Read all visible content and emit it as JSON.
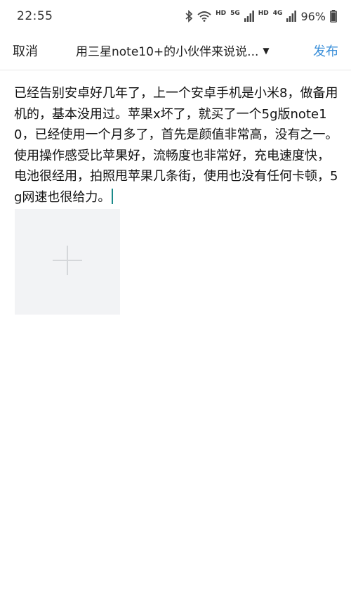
{
  "status_bar": {
    "time": "22:55",
    "network_label_1": "HD",
    "network_label_2": "5G",
    "network_label_3": "HD",
    "network_label_4": "4G",
    "battery": "96%",
    "icons": [
      "bluetooth-icon",
      "wifi-icon",
      "signal-icon",
      "signal-icon",
      "battery-icon"
    ]
  },
  "header": {
    "cancel_label": "取消",
    "topic_label": "用三星note10+的小伙伴来说说...",
    "publish_label": "发布",
    "publish_color": "#3a8fd9"
  },
  "editor": {
    "text": "已经告别安卓好几年了，上一个安卓手机是小米8，做备用机的，基本没用过。苹果x坏了，就买了一个5g版note10，已经使用一个月多了，首先是颜值非常高，没有之一。使用操作感受比苹果好，流畅度也非常好，充电速度快，电池很经用，拍照甩苹果几条街，使用也没有任何卡顿，5g网速也很给力。"
  },
  "add_image": {
    "icon": "plus-icon"
  }
}
